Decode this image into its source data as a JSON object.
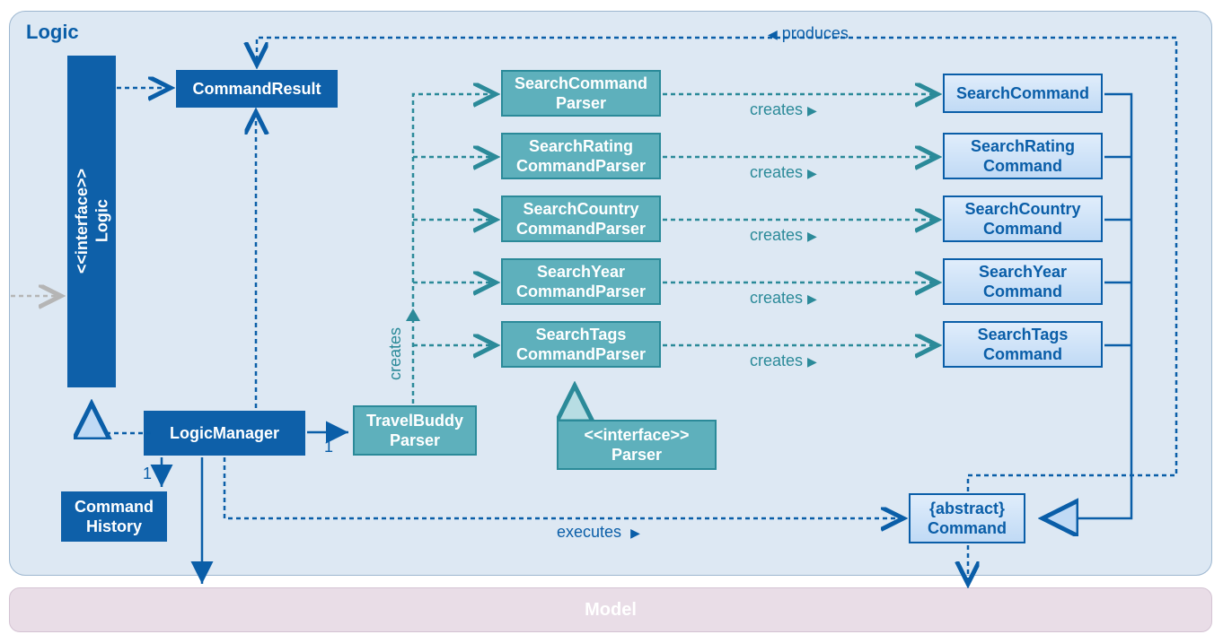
{
  "diagram": {
    "title": "Logic",
    "interface": {
      "stereo": "<<interface>>",
      "name": "Logic"
    },
    "commandResult": "CommandResult",
    "logicManager": "LogicManager",
    "commandHistory": "Command\nHistory",
    "travelBuddyParser": "TravelBuddy\nParser",
    "parserInterface": {
      "stereo": "<<interface>>",
      "name": "Parser"
    },
    "abstractCommand": {
      "stereo": "{abstract}",
      "name": "Command"
    },
    "parsers": [
      "SearchCommand\nParser",
      "SearchRating\nCommandParser",
      "SearchCountry\nCommandParser",
      "SearchYear\nCommandParser",
      "SearchTags\nCommandParser"
    ],
    "commands": [
      "SearchCommand",
      "SearchRating\nCommand",
      "SearchCountry\nCommand",
      "SearchYear\nCommand",
      "SearchTags\nCommand"
    ],
    "labels": {
      "produces": "produces",
      "creates": "creates",
      "executes": "executes"
    },
    "mult": {
      "one": "1"
    },
    "model": "Model"
  }
}
